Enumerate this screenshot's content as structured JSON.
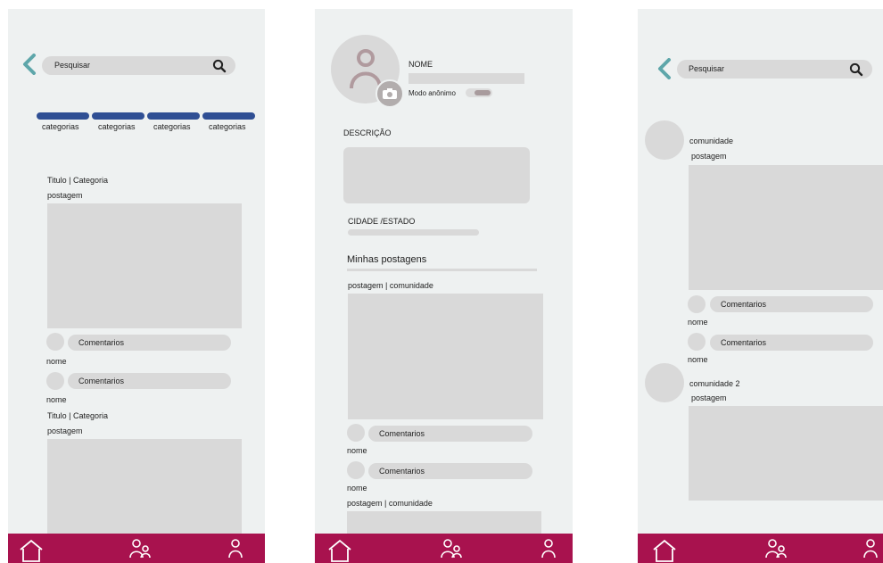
{
  "screen1": {
    "search": {
      "placeholder": "Pesquisar"
    },
    "categories": [
      "categorias",
      "categorias",
      "categorias",
      "categorias"
    ],
    "posts": [
      {
        "title": "Titulo | Categoria",
        "body": "postagem"
      },
      {
        "title": "Titulo | Categoria",
        "body": "postagem"
      }
    ],
    "comments": [
      {
        "label": "Comentarios",
        "author": "nome"
      },
      {
        "label": "Comentarios",
        "author": "nome"
      }
    ]
  },
  "screen2": {
    "name_label": "NOME",
    "anon_label": "Modo anônimo",
    "description_label": "DESCRIÇÃO",
    "city_label": "CIDADE /ESTADO",
    "my_posts_title": "Minhas postagens",
    "posts": [
      {
        "header": "postagem | comunidade"
      },
      {
        "header": "postagem | comunidade"
      }
    ],
    "comments": [
      {
        "label": "Comentarios",
        "author": "nome"
      },
      {
        "label": "Comentarios",
        "author": "nome"
      }
    ]
  },
  "screen3": {
    "search": {
      "placeholder": "Pesquisar"
    },
    "posts": [
      {
        "community": "comunidade",
        "body": "postagem"
      },
      {
        "community": "comunidade 2",
        "body": "postagem"
      }
    ],
    "comments": [
      {
        "label": "Comentarios",
        "author": "nome"
      },
      {
        "label": "Comentarios",
        "author": "nome"
      }
    ]
  },
  "colors": {
    "nav_bar": "#a8124e",
    "category_bar": "#2f4f94",
    "back_arrow": "#5ea6aa",
    "placeholder_gray": "#d9d9d9",
    "screen_bg": "#eef1f1"
  },
  "icons": {
    "back": "chevron-left-icon",
    "search": "search-icon",
    "home": "home-icon",
    "community": "users-icon",
    "profile": "user-icon",
    "camera": "camera-icon",
    "avatar": "avatar-icon"
  }
}
